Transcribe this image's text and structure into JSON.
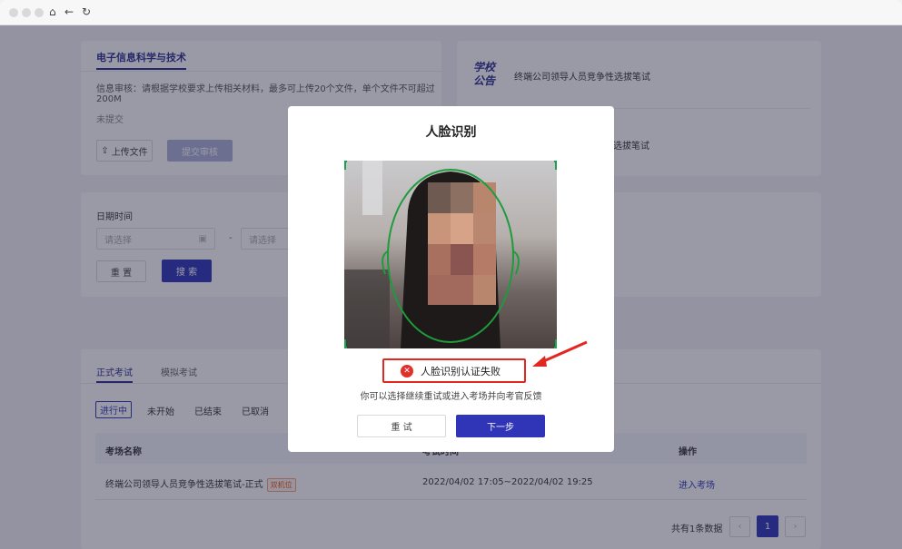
{
  "upload_card": {
    "tab_title": "电子信息科学与技术",
    "notice_line1": "信息审核：请根据学校要求上传相关材料，最多可上传20个文件，单个文件不可超过",
    "notice_line2": "200M",
    "status": "未提交",
    "upload_label": "上传文件",
    "submit_label": "提交审核"
  },
  "announcements": {
    "logo": [
      "学校",
      "公告"
    ],
    "items": [
      "终端公司领导人员竞争性选拔笔试",
      "选拔笔试"
    ]
  },
  "filter": {
    "label": "日期时间",
    "start_placeholder": "请选择",
    "end_placeholder": "请选择",
    "separator": "-",
    "reset_label": "重 置",
    "search_label": "搜 索"
  },
  "exam_section": {
    "tabs": [
      "正式考试",
      "模拟考试"
    ],
    "status_tabs": [
      "进行中",
      "未开始",
      "已结束",
      "已取消"
    ],
    "columns": [
      "考场名称",
      "考试时间",
      "操作"
    ],
    "rows": [
      {
        "name": "终端公司领导人员竞争性选拔笔试-正式",
        "badge": "双机位",
        "time": "2022/04/02 17:05~2022/04/02 19:25",
        "action": "进入考场"
      }
    ],
    "total": "共有1条数据",
    "page": "1"
  },
  "modal": {
    "title": "人脸识别",
    "error_text": "人脸识别认证失败",
    "hint": "你可以选择继续重试或进入考场并向考官反馈",
    "retry_label": "重 试",
    "next_label": "下一步"
  },
  "colors": {
    "primary": "#2f35b6",
    "error": "#e0322b",
    "face_outline": "#1f9a3c"
  }
}
